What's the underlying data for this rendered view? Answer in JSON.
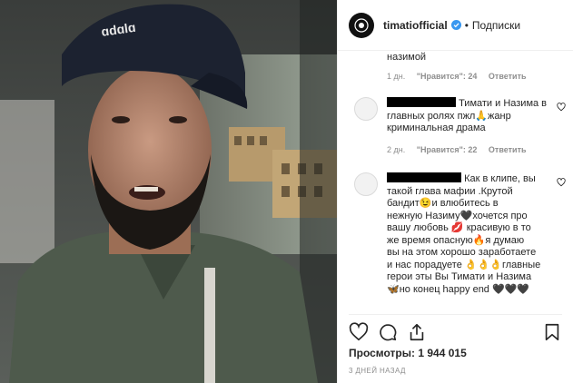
{
  "post": {
    "username": "timatiofficial",
    "follow_label": "Подписки",
    "separator": "•"
  },
  "comments": {
    "continued": {
      "text": "назимой",
      "time": "1 дн.",
      "likes": "\"Нравится\": 24",
      "reply": "Ответить"
    },
    "items": [
      {
        "text_lines": [
          "Тимати и Назима в",
          "главных ролях пжл🙏жанр",
          "криминальная драма"
        ],
        "time": "2 дн.",
        "likes": "\"Нравится\": 22",
        "reply": "Ответить"
      },
      {
        "text_lines": [
          "Как в клипе, вы",
          "такой глава мафии .Крутой",
          "бандит😉и влюбитесь в",
          "нежную Назиму🖤хочется про",
          "вашу любовь 💋 красивую в то",
          "же время опасную🔥я думаю",
          "вы на этом хорошо заработаете",
          "и нас порадуете 👌👌👌главные",
          "герои эты Вы Тимати и Назима",
          "🦋но конец happy end 🖤🖤🖤"
        ]
      }
    ]
  },
  "stats": {
    "views_label": "Просмотры:",
    "views_value": "1 944 015",
    "posted_ago": "3 ДНЕЙ НАЗАД"
  },
  "icons": {
    "like": "heart-icon",
    "comment": "comment-icon",
    "share": "share-icon",
    "save": "bookmark-icon",
    "verified": "verified-badge-icon"
  },
  "colors": {
    "verified": "#3897f0",
    "secondary_text": "#8e8e8e",
    "divider": "#efefef"
  }
}
